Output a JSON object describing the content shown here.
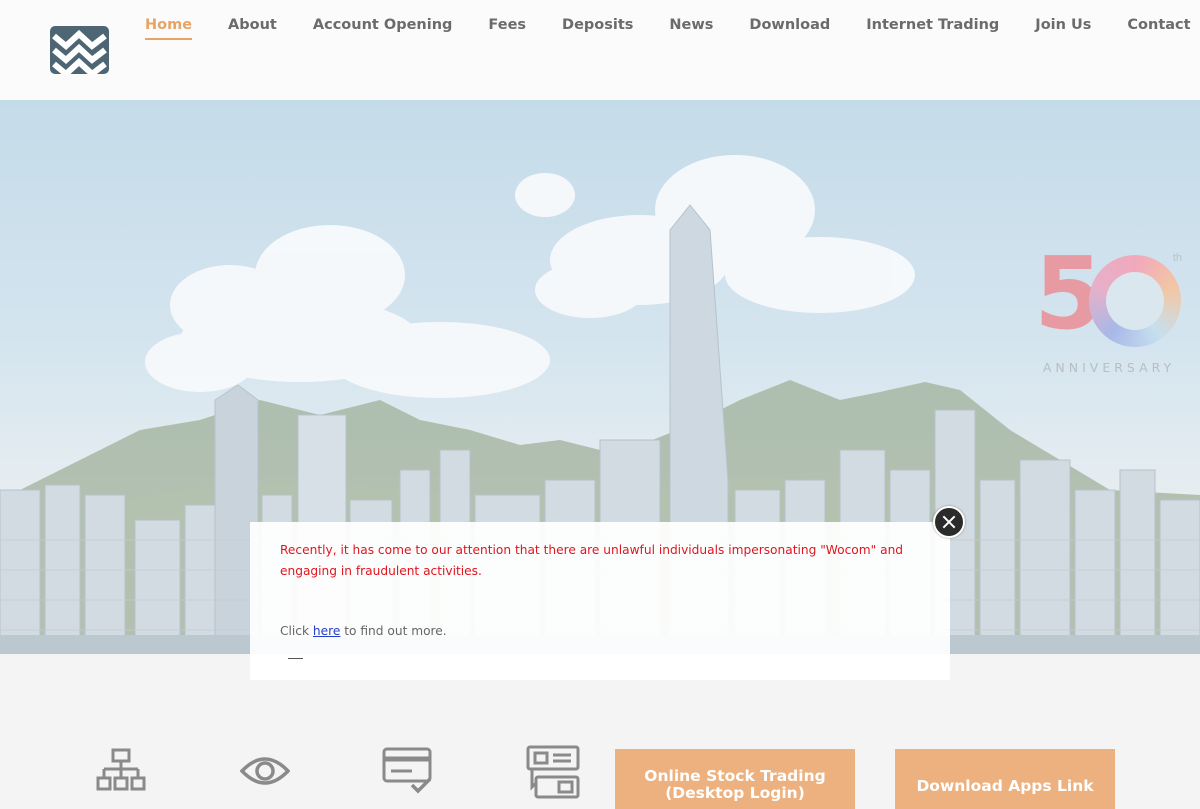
{
  "nav": {
    "items": [
      "Home",
      "About",
      "Account Opening",
      "Fees",
      "Deposits",
      "News",
      "Download",
      "Internet Trading",
      "Join Us",
      "Contact"
    ],
    "active": "Home"
  },
  "hero": {
    "anniversary_number": "50",
    "anniversary_superscript": "th",
    "anniversary_label": "ANNIVERSARY"
  },
  "popup": {
    "alert_text": "Recently, it has come to our attention that there are unlawful individuals impersonating \"Wocom\" and engaging in fraudulent activities.",
    "more_prefix": "Click",
    "more_link": "here",
    "more_suffix": "to find out more."
  },
  "features": {
    "icons": [
      "sitemap-icon",
      "eye-icon",
      "credit-card-check-icon",
      "transfer-icon"
    ]
  },
  "cta": {
    "online_trading_line1": "Online Stock Trading",
    "online_trading_line2": "(Desktop Login)",
    "download_apps": "Download Apps Link"
  },
  "colors": {
    "accent": "#e8a465",
    "alert_red": "#e0161f",
    "link_blue": "#2440c8",
    "logo_bg": "#4e6674",
    "cta_bg": "#ecb17e"
  }
}
